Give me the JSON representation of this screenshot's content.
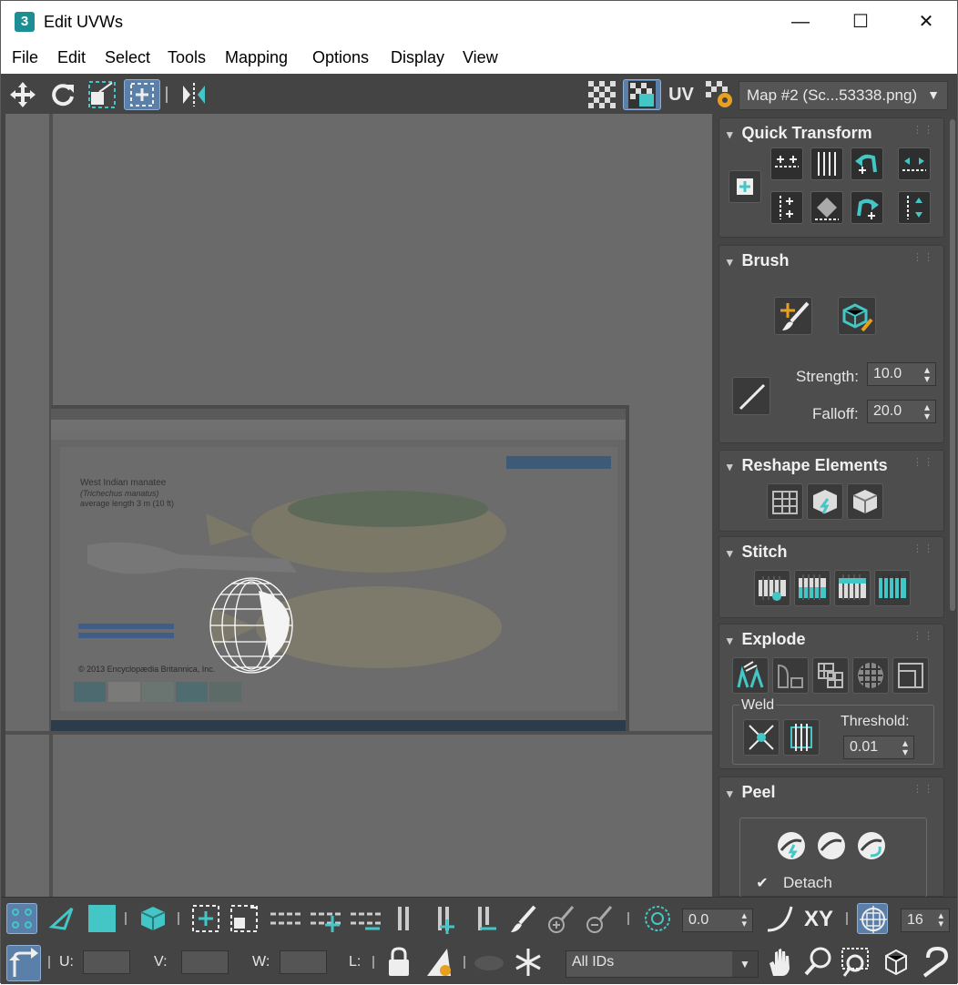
{
  "window": {
    "title": "Edit UVWs",
    "app_icon_text": "3",
    "minimize": "—",
    "maximize": "☐",
    "close": "✕"
  },
  "menu": [
    "File",
    "Edit",
    "Select",
    "Tools",
    "Mapping",
    "Options",
    "Display",
    "View"
  ],
  "toolbar": {
    "uv_label": "UV",
    "map_select": "Map #2 (Sc...53338.png)"
  },
  "texture": {
    "title": "West Indian manatee",
    "latin": "(Trichechus manatus)",
    "length": "average length 3 m (10 ft)",
    "credit": "© 2013 Encyclopædia Britannica, Inc."
  },
  "rollouts": {
    "quick_transform": {
      "title": "Quick Transform"
    },
    "brush": {
      "title": "Brush",
      "strength_label": "Strength:",
      "strength_value": "10.0",
      "falloff_label": "Falloff:",
      "falloff_value": "20.0"
    },
    "reshape": {
      "title": "Reshape Elements"
    },
    "stitch": {
      "title": "Stitch"
    },
    "explode": {
      "title": "Explode",
      "weld_label": "Weld",
      "threshold_label": "Threshold:",
      "threshold_value": "0.01"
    },
    "peel": {
      "title": "Peel",
      "detach_label": "Detach",
      "detach_checked": true
    }
  },
  "bottom": {
    "angle_value": "0.0",
    "xy_label": "XY",
    "grid_value": "16",
    "u_label": "U:",
    "v_label": "V:",
    "w_label": "W:",
    "l_label": "L:",
    "ids_select": "All IDs"
  },
  "colors": {
    "accent": "#44c6c6",
    "selected": "#5a7fa8",
    "background": "#444444",
    "viewport": "#6a6a6a"
  }
}
